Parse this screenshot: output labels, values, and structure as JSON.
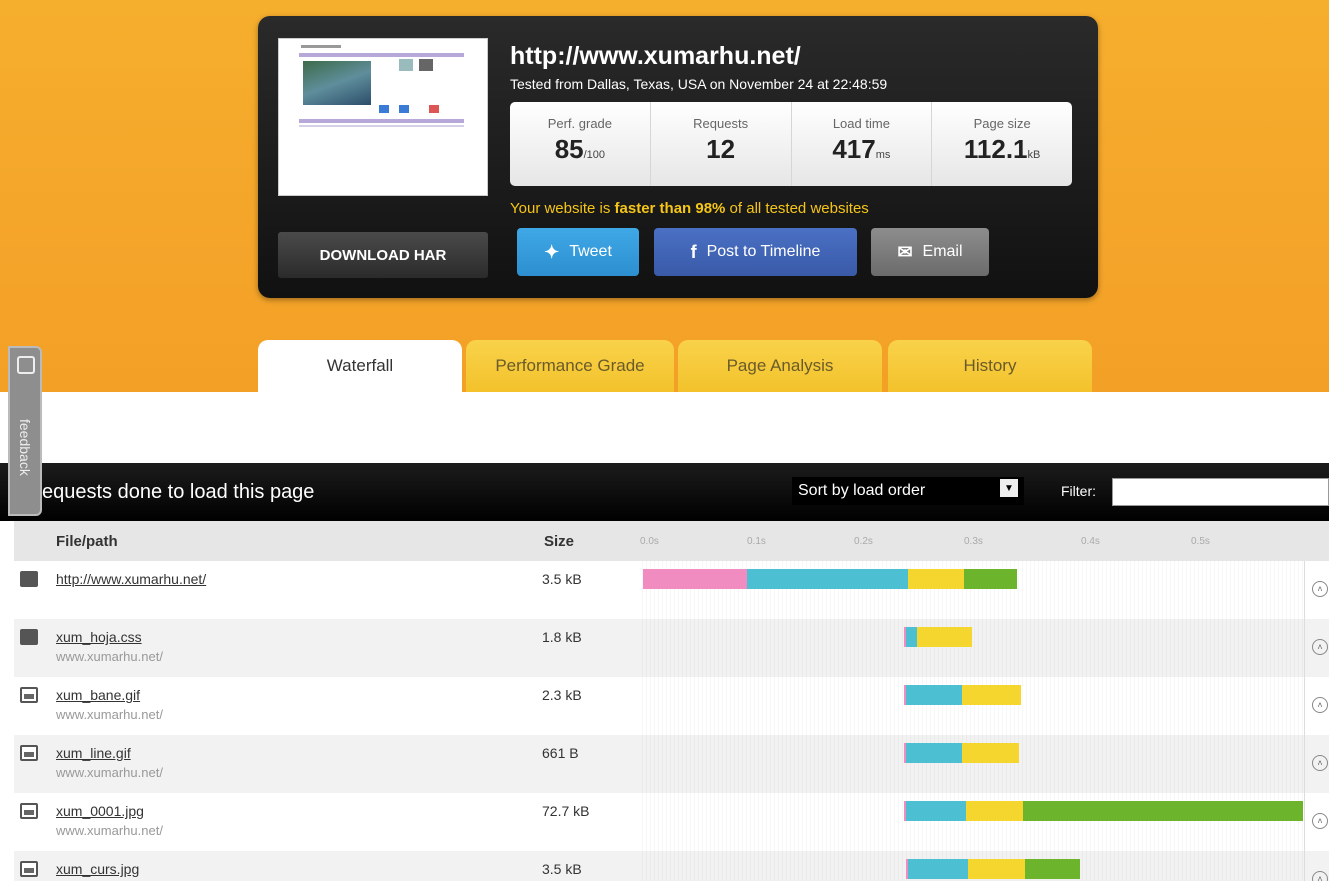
{
  "summary": {
    "url": "http://www.xumarhu.net/",
    "tested_from": "Tested from Dallas, Texas, USA on November 24 at 22:48:59",
    "download_label": "DOWNLOAD HAR",
    "stats": [
      {
        "label": "Perf. grade",
        "value": "85",
        "unit": "/100"
      },
      {
        "label": "Requests",
        "value": "12",
        "unit": ""
      },
      {
        "label": "Load time",
        "value": "417",
        "unit": "ms"
      },
      {
        "label": "Page size",
        "value": "112.1",
        "unit": "kB"
      }
    ],
    "faster_prefix": "Your website is ",
    "faster_bold": "faster than 98%",
    "faster_suffix": " of all tested websites",
    "share": {
      "tweet": "Tweet",
      "facebook": "Post to Timeline",
      "email": "Email"
    }
  },
  "tabs": [
    {
      "label": "Waterfall",
      "active": true
    },
    {
      "label": "Performance Grade",
      "active": false
    },
    {
      "label": "Page Analysis",
      "active": false
    },
    {
      "label": "History",
      "active": false
    }
  ],
  "feedback_label": "feedback",
  "requests_bar": {
    "title": "equests done to load this page",
    "sort_label": "Sort by load order",
    "filter_label": "Filter:"
  },
  "table": {
    "col_file": "File/path",
    "col_size": "Size",
    "ticks": [
      "0.0s",
      "0.1s",
      "0.2s",
      "0.3s",
      "0.4s",
      "0.5s"
    ],
    "rows": [
      {
        "icon": "html",
        "name": "http://www.xumarhu.net/",
        "host": "",
        "size": "3.5 kB",
        "timing_s": {
          "dns": [
            0.0,
            0.055
          ],
          "connect": [
            0.055,
            0.14
          ],
          "wait": [
            0.14,
            0.17
          ],
          "recv": [
            0.17,
            0.198
          ]
        }
      },
      {
        "icon": "css",
        "name": "xum_hoja.css",
        "host": "www.xumarhu.net/",
        "size": "1.8 kB",
        "timing_s": {
          "dns": [
            0.138,
            0.139
          ],
          "connect": [
            0.139,
            0.145
          ],
          "wait": [
            0.145,
            0.174
          ],
          "recv": null
        }
      },
      {
        "icon": "img",
        "name": "xum_bane.gif",
        "host": "www.xumarhu.net/",
        "size": "2.3 kB",
        "timing_s": {
          "dns": [
            0.138,
            0.139
          ],
          "connect": [
            0.139,
            0.169
          ],
          "wait": [
            0.169,
            0.2
          ],
          "recv": null
        }
      },
      {
        "icon": "img",
        "name": "xum_line.gif",
        "host": "www.xumarhu.net/",
        "size": "661 B",
        "timing_s": {
          "dns": [
            0.138,
            0.139
          ],
          "connect": [
            0.139,
            0.169
          ],
          "wait": [
            0.169,
            0.199
          ],
          "recv": null
        }
      },
      {
        "icon": "img",
        "name": "xum_0001.jpg",
        "host": "www.xumarhu.net/",
        "size": "72.7 kB",
        "timing_s": {
          "dns": [
            0.138,
            0.139
          ],
          "connect": [
            0.139,
            0.171
          ],
          "wait": [
            0.171,
            0.201
          ],
          "recv": [
            0.201,
            0.349
          ]
        }
      },
      {
        "icon": "img",
        "name": "xum_curs.jpg",
        "host": "",
        "size": "3.5 kB",
        "timing_s": {
          "dns": [
            0.139,
            0.14
          ],
          "connect": [
            0.14,
            0.172
          ],
          "wait": [
            0.172,
            0.202
          ],
          "recv": [
            0.202,
            0.231
          ]
        }
      }
    ]
  },
  "colors": {
    "orange": "#f4a52a",
    "dns": "#f08cc0",
    "connect": "#4dbfd3",
    "wait": "#f5d62e",
    "recv": "#6cb42c"
  }
}
